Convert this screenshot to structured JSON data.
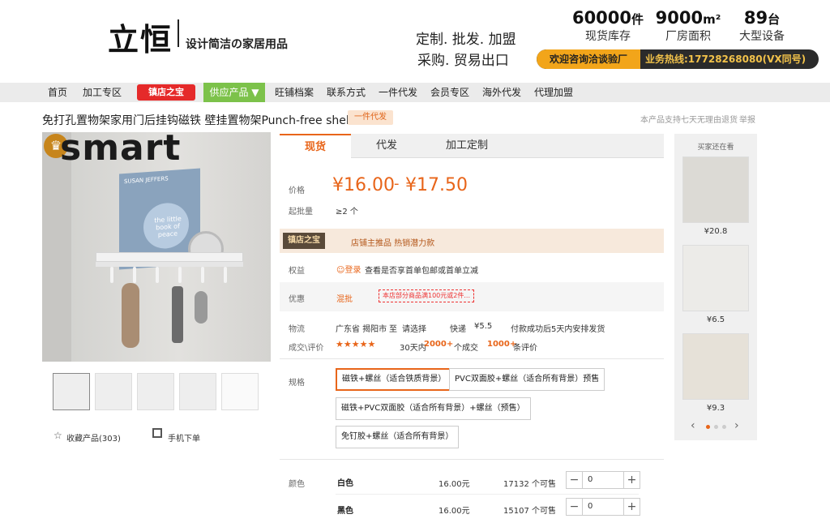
{
  "header": {
    "brand": "立恒",
    "slogan": "设计简洁の家居用品",
    "services_line1": "定制. 批发. 加盟",
    "services_line2": "采购. 贸易出口",
    "stats": [
      {
        "num": "60000",
        "unit": "件",
        "label": "现货库存"
      },
      {
        "num": "9000",
        "unit": "m²",
        "label": "厂房面积"
      },
      {
        "num": "89",
        "unit": "台",
        "label": "大型设备"
      }
    ],
    "consult": "欢迎咨询洽谈验厂",
    "hotline": "业务热线:17728268080(VX同号)"
  },
  "nav": {
    "items": [
      "首页",
      "加工专区",
      "旺铺档案",
      "联系方式",
      "一件代发",
      "会员专区",
      "海外代发",
      "代理加盟"
    ],
    "badge": "镇店之宝",
    "supply": "供应产品 ▼"
  },
  "product": {
    "title": "免打孔置物架家用门后挂钩磁铁 壁挂置物架Punch-free shelf",
    "badge": "一件代发",
    "support_note": "本产品支持七天无理由退货",
    "report": "举报",
    "brand_overlay": "smart",
    "book_title": "SUSAN JEFFERS",
    "book_sub": "the little book of peace",
    "favorite": "收藏产品(303)",
    "mobile_order": "手机下单"
  },
  "tabs": [
    "现货",
    "代发",
    "加工定制"
  ],
  "pricing": {
    "price_label": "价格",
    "price_low": "¥16.00",
    "price_sep": "-",
    "price_high": "¥17.50",
    "moq_label": "起批量",
    "moq": "≥2 个"
  },
  "treasure": {
    "badge": "镇店之宝",
    "text": "店铺主推品  热销潜力款"
  },
  "rights": {
    "label": "权益",
    "login": "登录",
    "text": "查看是否享首单包邮或首单立减"
  },
  "discount": {
    "label": "优惠",
    "type": "混批",
    "coupon": "本店部分商品满100元或2件..."
  },
  "logistics": {
    "label": "物流",
    "from": "广东省 揭阳市",
    "to_word": "至",
    "to": "请选择",
    "express": "快递",
    "fee": "¥5.5",
    "ship_note": "付款成功后5天内安排发货"
  },
  "deals": {
    "label": "成交\\评价",
    "stars": "★★★★★",
    "days": "30天内",
    "count": "2000+",
    "count_unit": "个成交",
    "reviews": "1000+",
    "reviews_unit": "条评价"
  },
  "specs": {
    "label": "规格",
    "options": [
      "磁铁+螺丝（适合铁质背景）",
      "PVC双面胶+螺丝（适合所有背景）预售",
      "磁铁+PVC双面胶（适合所有背景）+螺丝（预售）",
      "免钉胶+螺丝（适合所有背景）"
    ]
  },
  "colors": {
    "label": "颜色",
    "rows": [
      {
        "name": "白色",
        "price": "16.00元",
        "stock": "17132 个可售",
        "qty": "0"
      },
      {
        "name": "黑色",
        "price": "16.00元",
        "stock": "15107 个可售",
        "qty": "0"
      }
    ]
  },
  "side": {
    "title": "买家还在看",
    "items": [
      {
        "price": "¥20.8"
      },
      {
        "price": "¥6.5"
      },
      {
        "price": "¥9.3"
      }
    ]
  },
  "colors_theme": {
    "accent": "#e8651a",
    "nav_bg": "#ebebeb",
    "supply_green": "#7cc24a",
    "badge_red": "#e52a2a"
  }
}
